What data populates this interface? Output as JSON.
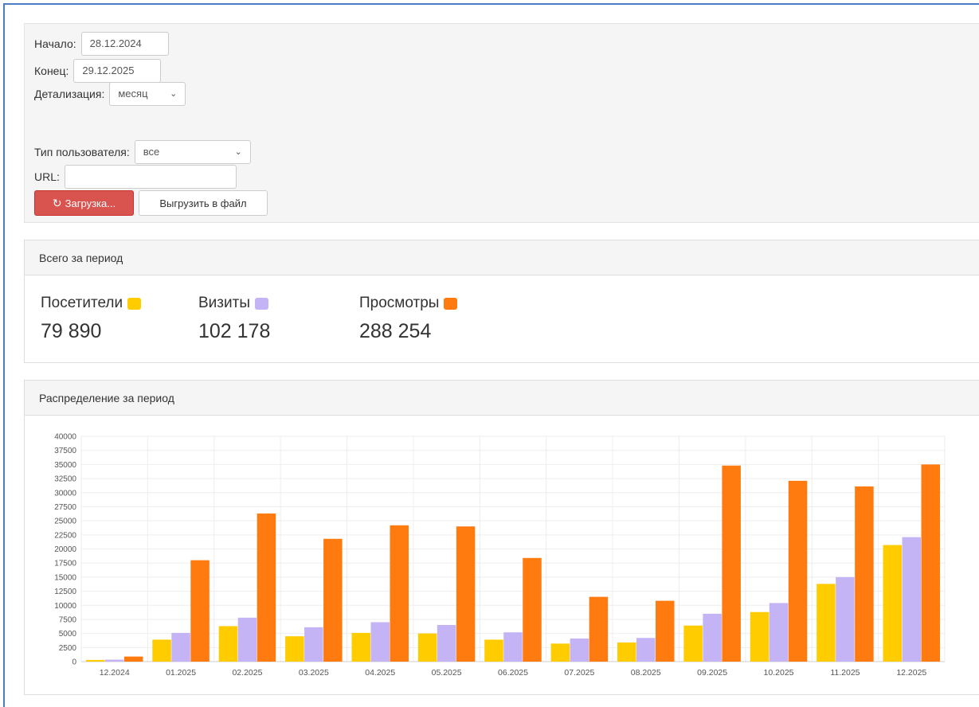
{
  "filters": {
    "start_label": "Начало:",
    "start_value": "28.12.2024",
    "end_label": "Конец:",
    "end_value": "29.12.2025",
    "detail_label": "Детализация:",
    "detail_value": "месяц",
    "user_type_label": "Тип пользователя:",
    "user_type_value": "все",
    "url_label": "URL:",
    "url_value": "",
    "load_button": "Загрузка...",
    "export_button": "Выгрузить в файл"
  },
  "totals": {
    "title": "Всего за период",
    "visitors_label": "Посетители",
    "visitors_value": "79 890",
    "visits_label": "Визиты",
    "visits_value": "102 178",
    "views_label": "Просмотры",
    "views_value": "288 254"
  },
  "distribution": {
    "title": "Распределение за период"
  },
  "colors": {
    "visitors": "#ffcc00",
    "visits": "#c4b3f5",
    "views": "#ff7a0f",
    "danger": "#d9534f"
  },
  "icons": {
    "load": "refresh-icon",
    "select": "chevron-down-icon"
  },
  "chart_data": {
    "type": "bar",
    "categories": [
      "12.2024",
      "01.2025",
      "02.2025",
      "03.2025",
      "04.2025",
      "05.2025",
      "06.2025",
      "07.2025",
      "08.2025",
      "09.2025",
      "10.2025",
      "11.2025",
      "12.2025"
    ],
    "series": [
      {
        "name": "Посетители",
        "values": [
          300,
          3900,
          6300,
          4500,
          5100,
          5000,
          3900,
          3200,
          3400,
          6400,
          8800,
          13800,
          20700
        ]
      },
      {
        "name": "Визиты",
        "values": [
          350,
          5100,
          7800,
          6100,
          7000,
          6500,
          5200,
          4100,
          4200,
          8500,
          10400,
          15000,
          22100
        ]
      },
      {
        "name": "Просмотры",
        "values": [
          900,
          18000,
          26300,
          21800,
          24200,
          24000,
          18400,
          11500,
          10800,
          34800,
          32100,
          31100,
          35000
        ]
      }
    ],
    "yticks": [
      0,
      2500,
      5000,
      7500,
      10000,
      12500,
      15000,
      17500,
      20000,
      22500,
      25000,
      27500,
      30000,
      32500,
      35000,
      37500,
      40000
    ],
    "ylim": [
      0,
      40000
    ],
    "grid": true
  }
}
